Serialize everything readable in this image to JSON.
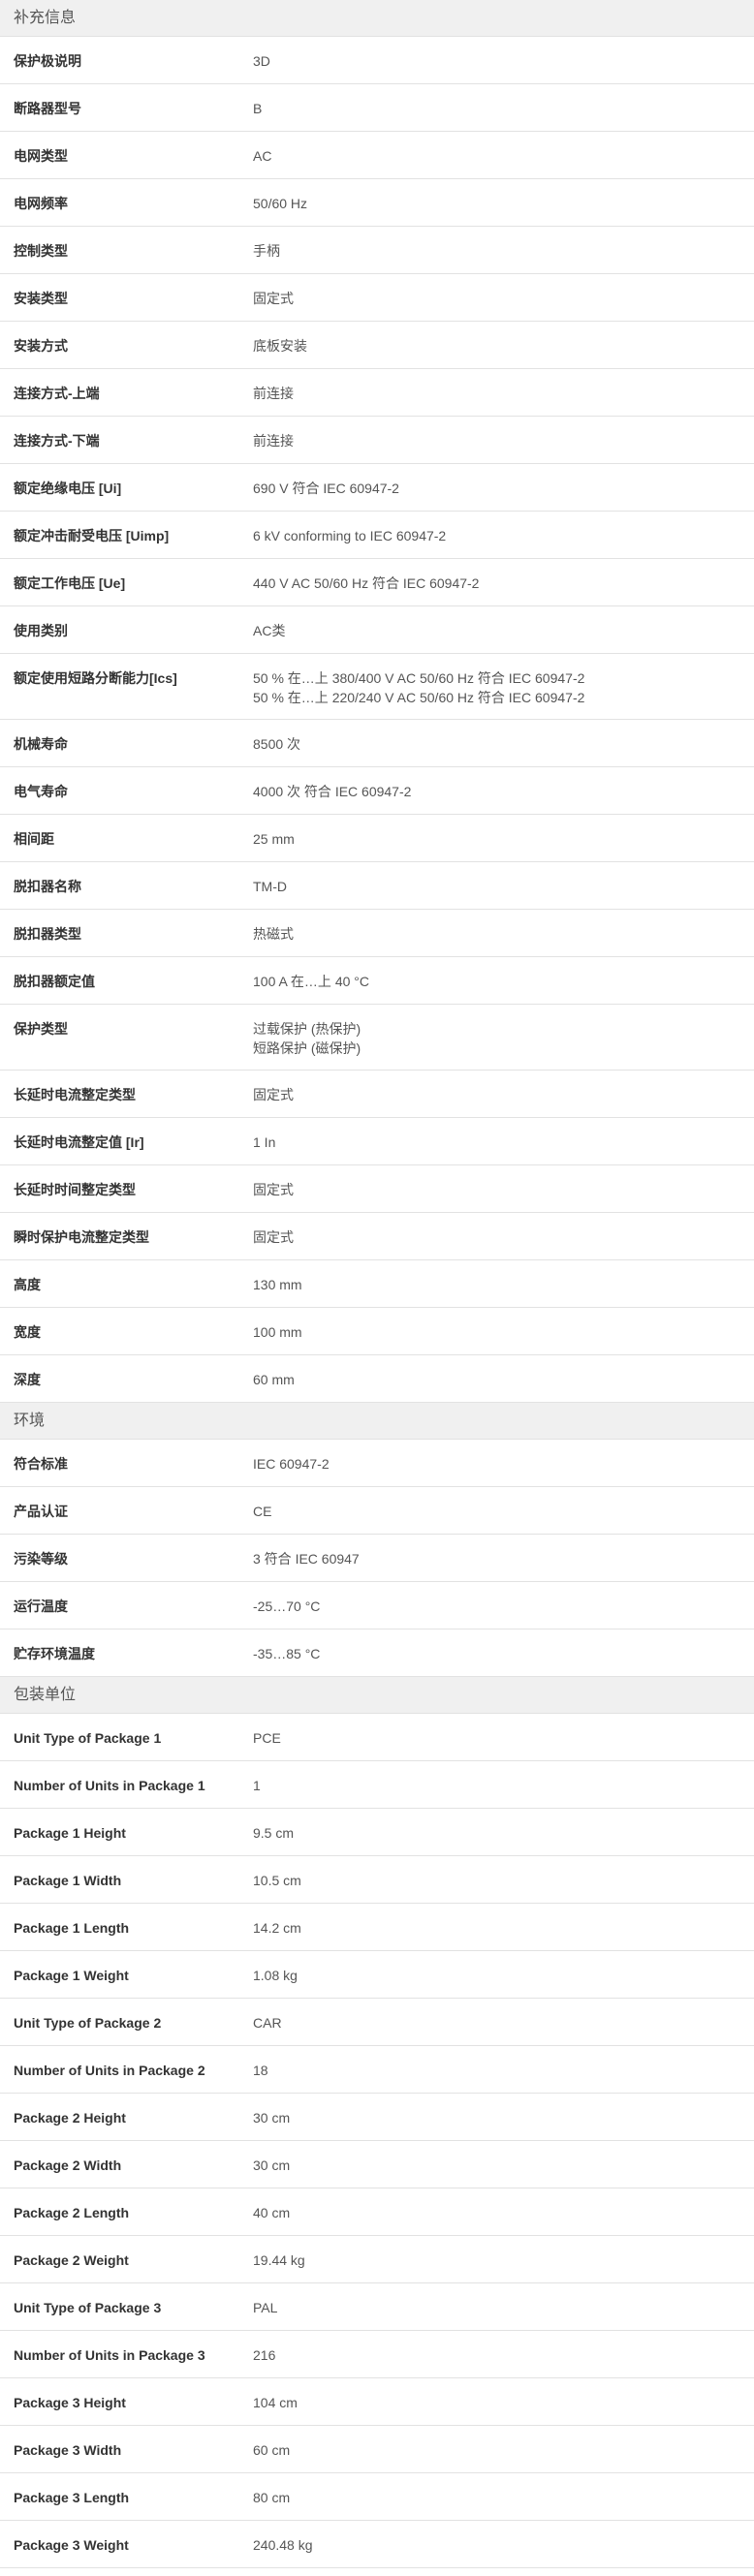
{
  "sections": [
    {
      "title": "补充信息",
      "rows": [
        {
          "label": "保护极说明",
          "values": [
            "3D"
          ]
        },
        {
          "label": "断路器型号",
          "values": [
            "B"
          ]
        },
        {
          "label": "电网类型",
          "values": [
            "AC"
          ]
        },
        {
          "label": "电网频率",
          "values": [
            "50/60 Hz"
          ]
        },
        {
          "label": "控制类型",
          "values": [
            "手柄"
          ]
        },
        {
          "label": "安装类型",
          "values": [
            "固定式"
          ]
        },
        {
          "label": "安装方式",
          "values": [
            "底板安装"
          ]
        },
        {
          "label": "连接方式-上端",
          "values": [
            "前连接"
          ]
        },
        {
          "label": "连接方式-下端",
          "values": [
            "前连接"
          ]
        },
        {
          "label": "额定绝缘电压 [Ui]",
          "values": [
            "690 V 符合 IEC 60947-2"
          ]
        },
        {
          "label": "额定冲击耐受电压 [Uimp]",
          "values": [
            "6 kV conforming to IEC 60947-2"
          ]
        },
        {
          "label": "额定工作电压 [Ue]",
          "values": [
            "440 V AC 50/60 Hz 符合 IEC 60947-2"
          ]
        },
        {
          "label": "使用类别",
          "values": [
            "AC类"
          ]
        },
        {
          "label": "额定使用短路分断能力[Ics]",
          "values": [
            "50 % 在…上 380/400 V AC 50/60 Hz 符合 IEC 60947-2",
            "50 % 在…上 220/240 V AC 50/60 Hz 符合 IEC 60947-2"
          ]
        },
        {
          "label": "机械寿命",
          "values": [
            "8500 次"
          ]
        },
        {
          "label": "电气寿命",
          "values": [
            "4000 次 符合 IEC 60947-2"
          ]
        },
        {
          "label": "相间距",
          "values": [
            "25 mm"
          ]
        },
        {
          "label": "脱扣器名称",
          "values": [
            "TM-D"
          ]
        },
        {
          "label": "脱扣器类型",
          "values": [
            "热磁式"
          ]
        },
        {
          "label": "脱扣器额定值",
          "values": [
            "100 A 在…上 40 °C"
          ]
        },
        {
          "label": "保护类型",
          "values": [
            "过载保护 (热保护)",
            "短路保护 (磁保护)"
          ]
        },
        {
          "label": "长延时电流整定类型",
          "values": [
            "固定式"
          ]
        },
        {
          "label": "长延时电流整定值 [Ir]",
          "values": [
            "1 In"
          ]
        },
        {
          "label": "长延时时间整定类型",
          "values": [
            "固定式"
          ]
        },
        {
          "label": "瞬时保护电流整定类型",
          "values": [
            "固定式"
          ]
        },
        {
          "label": "高度",
          "values": [
            "130 mm"
          ]
        },
        {
          "label": "宽度",
          "values": [
            "100 mm"
          ]
        },
        {
          "label": "深度",
          "values": [
            "60 mm"
          ]
        }
      ]
    },
    {
      "title": "环境",
      "rows": [
        {
          "label": "符合标准",
          "values": [
            "IEC 60947-2"
          ]
        },
        {
          "label": "产品认证",
          "values": [
            "CE"
          ]
        },
        {
          "label": "污染等级",
          "values": [
            "3 符合 IEC 60947"
          ]
        },
        {
          "label": "运行温度",
          "values": [
            "-25…70 °C"
          ]
        },
        {
          "label": "贮存环境温度",
          "values": [
            "-35…85 °C"
          ]
        }
      ]
    },
    {
      "title": "包装单位",
      "rows": [
        {
          "label": "Unit Type of Package 1",
          "values": [
            "PCE"
          ]
        },
        {
          "label": "Number of Units in Package 1",
          "values": [
            "1"
          ]
        },
        {
          "label": "Package 1 Height",
          "values": [
            "9.5 cm"
          ]
        },
        {
          "label": "Package 1 Width",
          "values": [
            "10.5 cm"
          ]
        },
        {
          "label": "Package 1 Length",
          "values": [
            "14.2 cm"
          ]
        },
        {
          "label": "Package 1 Weight",
          "values": [
            "1.08 kg"
          ]
        },
        {
          "label": "Unit Type of Package 2",
          "values": [
            "CAR"
          ]
        },
        {
          "label": "Number of Units in Package 2",
          "values": [
            "18"
          ]
        },
        {
          "label": "Package 2 Height",
          "values": [
            "30 cm"
          ]
        },
        {
          "label": "Package 2 Width",
          "values": [
            "30 cm"
          ]
        },
        {
          "label": "Package 2 Length",
          "values": [
            "40 cm"
          ]
        },
        {
          "label": "Package 2 Weight",
          "values": [
            "19.44 kg"
          ]
        },
        {
          "label": "Unit Type of Package 3",
          "values": [
            "PAL"
          ]
        },
        {
          "label": "Number of Units in Package 3",
          "values": [
            "216"
          ]
        },
        {
          "label": "Package 3 Height",
          "values": [
            "104 cm"
          ]
        },
        {
          "label": "Package 3 Width",
          "values": [
            "60 cm"
          ]
        },
        {
          "label": "Package 3 Length",
          "values": [
            "80 cm"
          ]
        },
        {
          "label": "Package 3 Weight",
          "values": [
            "240.48 kg"
          ]
        }
      ]
    }
  ]
}
